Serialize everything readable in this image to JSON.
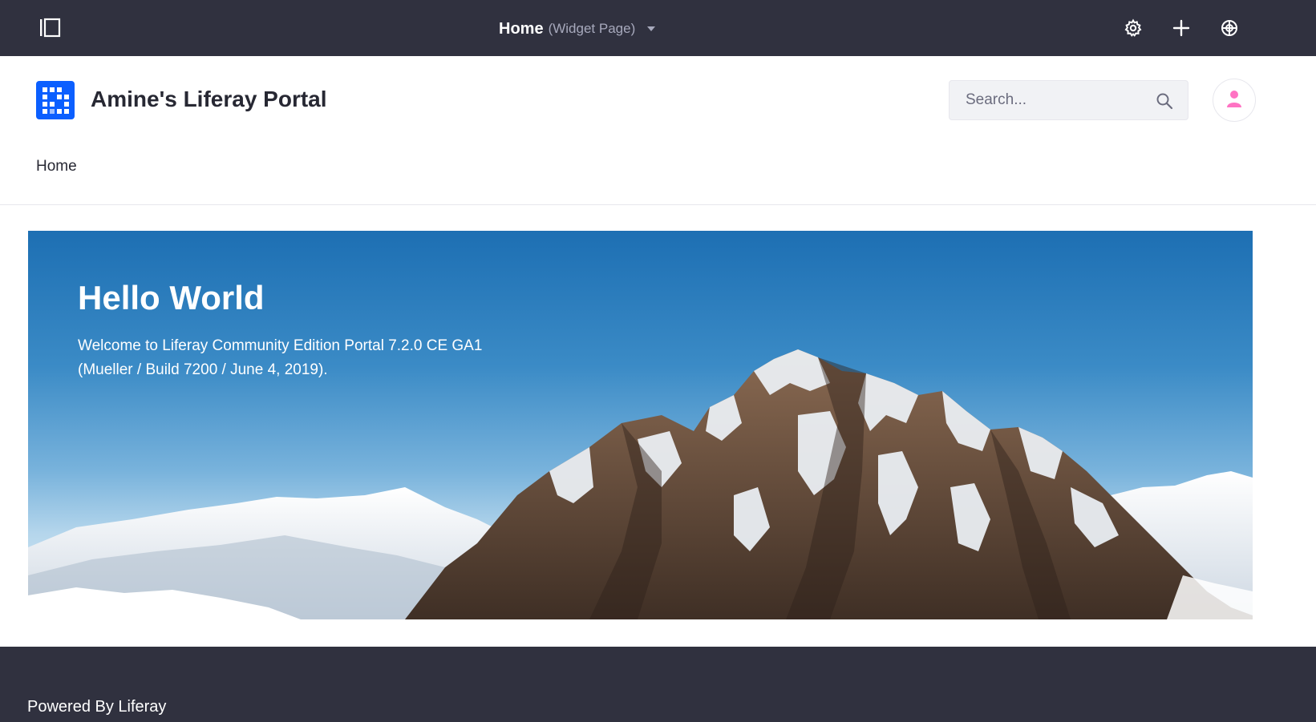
{
  "control_menu": {
    "page_name": "Home",
    "page_type": "(Widget Page)",
    "icons": {
      "product_menu": "product-menu-toggle-icon",
      "settings": "gear-icon",
      "add": "plus-icon",
      "simulation": "simulation-icon",
      "caret": "caret-down-icon"
    }
  },
  "header": {
    "site_name": "Amine's Liferay Portal",
    "search": {
      "placeholder": "Search...",
      "value": ""
    },
    "nav": {
      "items": [
        {
          "label": "Home"
        }
      ]
    }
  },
  "banner": {
    "title": "Hello World",
    "text": "Welcome to Liferay Community Edition Portal 7.2.0 CE GA1 (Mueller / Build 7200 / June 4, 2019)."
  },
  "footer": {
    "text": "Powered By Liferay"
  },
  "colors": {
    "control_menu_bg": "#30313f",
    "logo_blue": "#0b5fff",
    "avatar_pink": "#ff73c3",
    "footer_bg": "#30313f"
  }
}
